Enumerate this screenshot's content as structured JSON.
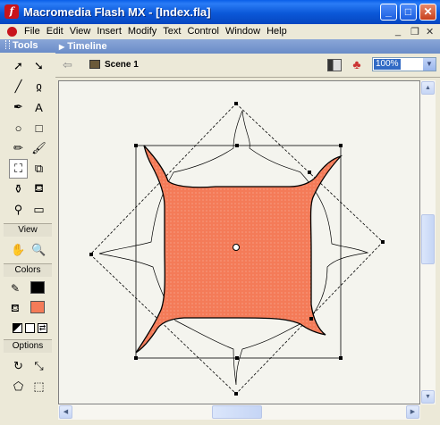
{
  "window": {
    "title": "Macromedia Flash MX - [Index.fla]",
    "app_icon": "flash-icon",
    "controls": [
      "minimize-icon",
      "maximize-icon",
      "close-icon"
    ]
  },
  "menubar": {
    "items": [
      "File",
      "Edit",
      "View",
      "Insert",
      "Modify",
      "Text",
      "Control",
      "Window",
      "Help"
    ],
    "mdi_controls": [
      "_",
      "❐",
      "✕"
    ]
  },
  "tools": {
    "title": "Tools",
    "items": [
      {
        "name": "arrow-tool",
        "glyph": "➚"
      },
      {
        "name": "subselect-tool",
        "glyph": "➘"
      },
      {
        "name": "line-tool",
        "glyph": "╱"
      },
      {
        "name": "lasso-tool",
        "glyph": "ჲ"
      },
      {
        "name": "pen-tool",
        "glyph": "✒"
      },
      {
        "name": "text-tool",
        "glyph": "A"
      },
      {
        "name": "oval-tool",
        "glyph": "○"
      },
      {
        "name": "rectangle-tool",
        "glyph": "□"
      },
      {
        "name": "pencil-tool",
        "glyph": "✏"
      },
      {
        "name": "brush-tool",
        "glyph": "🖌"
      },
      {
        "name": "free-transform-tool",
        "glyph": "⛶"
      },
      {
        "name": "fill-transform-tool",
        "glyph": "⧉"
      },
      {
        "name": "ink-bottle-tool",
        "glyph": "⚱"
      },
      {
        "name": "paint-bucket-tool",
        "glyph": "⛾"
      },
      {
        "name": "eyedropper-tool",
        "glyph": "⚲"
      },
      {
        "name": "eraser-tool",
        "glyph": "▭"
      }
    ],
    "view_label": "View",
    "view_items": [
      {
        "name": "hand-tool",
        "glyph": "✋"
      },
      {
        "name": "zoom-tool",
        "glyph": "🔍"
      }
    ],
    "colors_label": "Colors",
    "stroke_color": "#000000",
    "fill_color": "#f47b58",
    "options_label": "Options"
  },
  "timeline": {
    "label": "Timeline"
  },
  "editbar": {
    "scene": "Scene 1",
    "zoom": "100%"
  },
  "stage": {
    "shape_fill": "#f47b58",
    "stage_bg": "#f4f4ee"
  }
}
